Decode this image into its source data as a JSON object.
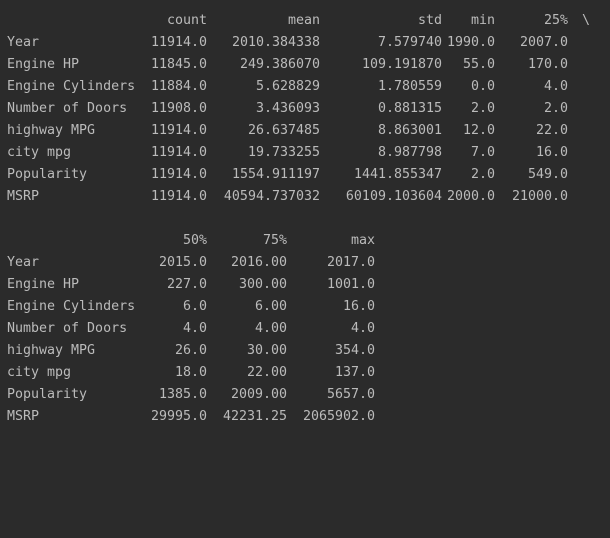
{
  "table1": {
    "columns": [
      "count",
      "mean",
      "std",
      "min",
      "25%"
    ],
    "continuation": "\\",
    "rows": [
      {
        "label": "Year",
        "values": [
          "11914.0",
          "2010.384338",
          "7.579740",
          "1990.0",
          "2007.0"
        ]
      },
      {
        "label": "Engine HP",
        "values": [
          "11845.0",
          "249.386070",
          "109.191870",
          "55.0",
          "170.0"
        ]
      },
      {
        "label": "Engine Cylinders",
        "values": [
          "11884.0",
          "5.628829",
          "1.780559",
          "0.0",
          "4.0"
        ]
      },
      {
        "label": "Number of Doors",
        "values": [
          "11908.0",
          "3.436093",
          "0.881315",
          "2.0",
          "2.0"
        ]
      },
      {
        "label": "highway MPG",
        "values": [
          "11914.0",
          "26.637485",
          "8.863001",
          "12.0",
          "22.0"
        ]
      },
      {
        "label": "city mpg",
        "values": [
          "11914.0",
          "19.733255",
          "8.987798",
          "7.0",
          "16.0"
        ]
      },
      {
        "label": "Popularity",
        "values": [
          "11914.0",
          "1554.911197",
          "1441.855347",
          "2.0",
          "549.0"
        ]
      },
      {
        "label": "MSRP",
        "values": [
          "11914.0",
          "40594.737032",
          "60109.103604",
          "2000.0",
          "21000.0"
        ]
      }
    ]
  },
  "table2": {
    "columns": [
      "50%",
      "75%",
      "max"
    ],
    "rows": [
      {
        "label": "Year",
        "values": [
          "2015.0",
          "2016.00",
          "2017.0"
        ]
      },
      {
        "label": "Engine HP",
        "values": [
          "227.0",
          "300.00",
          "1001.0"
        ]
      },
      {
        "label": "Engine Cylinders",
        "values": [
          "6.0",
          "6.00",
          "16.0"
        ]
      },
      {
        "label": "Number of Doors",
        "values": [
          "4.0",
          "4.00",
          "4.0"
        ]
      },
      {
        "label": "highway MPG",
        "values": [
          "26.0",
          "30.00",
          "354.0"
        ]
      },
      {
        "label": "city mpg",
        "values": [
          "18.0",
          "22.00",
          "137.0"
        ]
      },
      {
        "label": "Popularity",
        "values": [
          "1385.0",
          "2009.00",
          "5657.0"
        ]
      },
      {
        "label": "MSRP",
        "values": [
          "29995.0",
          "42231.25",
          "2065902.0"
        ]
      }
    ]
  }
}
